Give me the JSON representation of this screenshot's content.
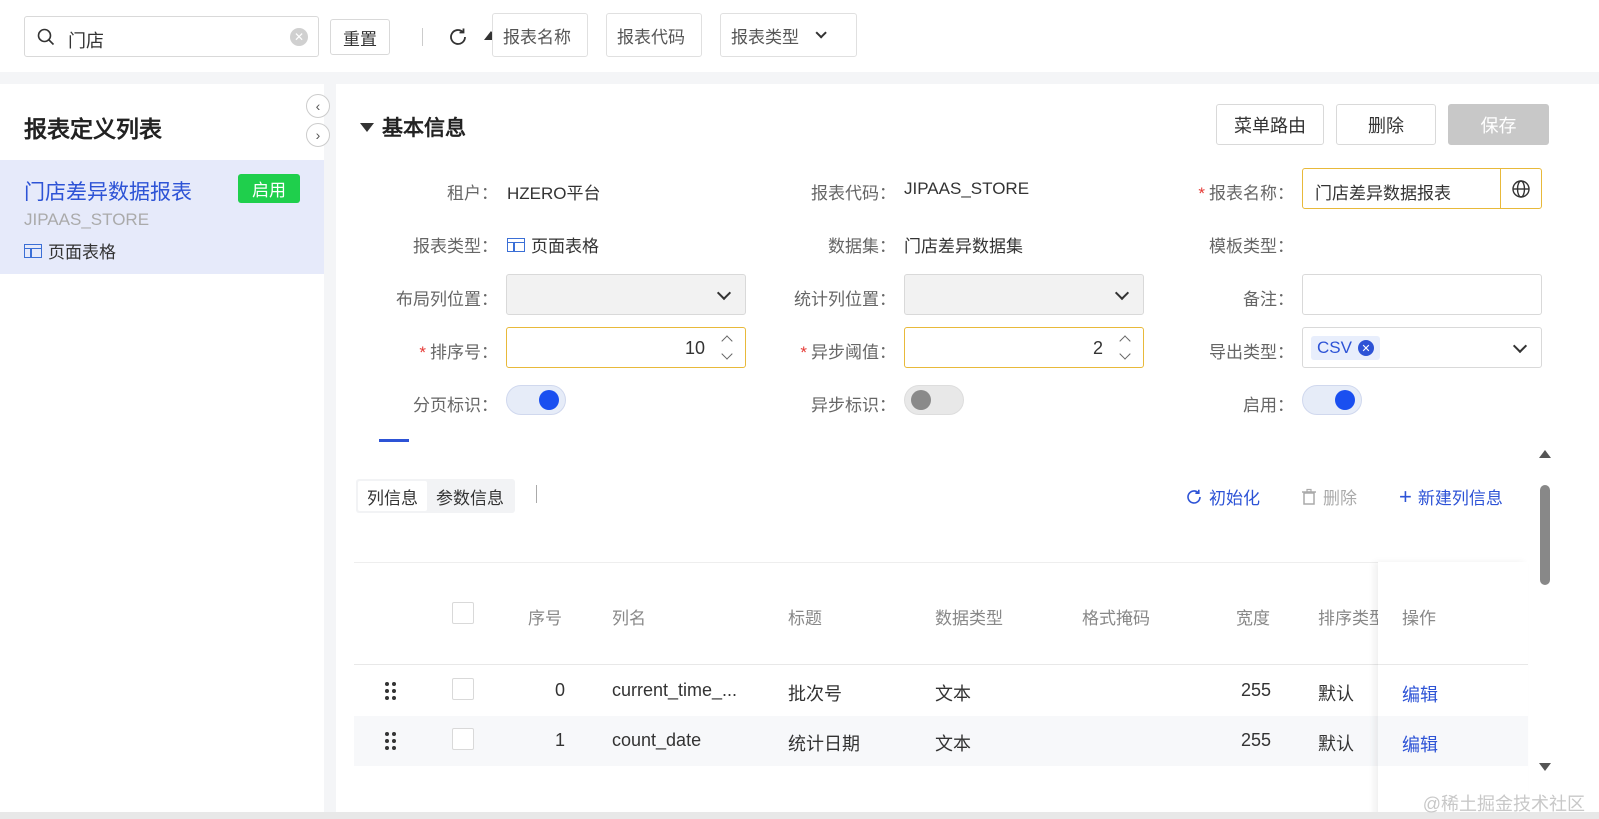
{
  "toolbar": {
    "search_value": "门店",
    "reset_label": "重置",
    "filters": [
      "报表名称",
      "报表代码",
      "报表类型"
    ]
  },
  "sidebar": {
    "title": "报表定义列表",
    "items": [
      {
        "name": "门店差异数据报表",
        "status": "启用",
        "code": "JIPAAS_STORE",
        "type": "页面表格"
      }
    ]
  },
  "detail": {
    "section_title": "基本信息",
    "actions": {
      "menu_route": "菜单路由",
      "delete": "删除",
      "save": "保存"
    },
    "fields": {
      "tenant_label": "租户：",
      "tenant_value": "HZERO平台",
      "code_label": "报表代码：",
      "code_value": "JIPAAS_STORE",
      "name_label": "报表名称：",
      "name_value": "门店差异数据报表",
      "type_label": "报表类型：",
      "type_value": "页面表格",
      "dataset_label": "数据集：",
      "dataset_value": "门店差异数据集",
      "template_label": "模板类型：",
      "layout_col_label": "布局列位置：",
      "stat_col_label": "统计列位置：",
      "remark_label": "备注：",
      "order_label": "排序号：",
      "order_value": "10",
      "async_threshold_label": "异步阈值：",
      "async_threshold_value": "2",
      "export_label": "导出类型：",
      "export_value": "CSV",
      "paging_label": "分页标识：",
      "async_flag_label": "异步标识：",
      "enabled_label": "启用："
    },
    "switches": {
      "paging": true,
      "async": false,
      "enabled": true
    }
  },
  "tabs": {
    "items": [
      "列信息",
      "参数信息"
    ],
    "active": 0,
    "tools": {
      "init": "初始化",
      "delete": "删除",
      "new_column": "新建列信息"
    }
  },
  "table": {
    "headers": [
      "序号",
      "列名",
      "标题",
      "数据类型",
      "格式掩码",
      "宽度",
      "排序类型",
      "操作"
    ],
    "rows": [
      {
        "seq": "0",
        "name": "current_time_...",
        "title": "批次号",
        "type": "文本",
        "mask": "",
        "width": "255",
        "sort": "默认",
        "op": "编辑"
      },
      {
        "seq": "1",
        "name": "count_date",
        "title": "统计日期",
        "type": "文本",
        "mask": "",
        "width": "255",
        "sort": "默认",
        "op": "编辑"
      }
    ]
  },
  "watermark": "@稀土掘金技术社区",
  "colors": {
    "primary": "#2d53d6",
    "success": "#1fcf4c",
    "required": "#e53935",
    "focus_border": "#e8b93a"
  }
}
